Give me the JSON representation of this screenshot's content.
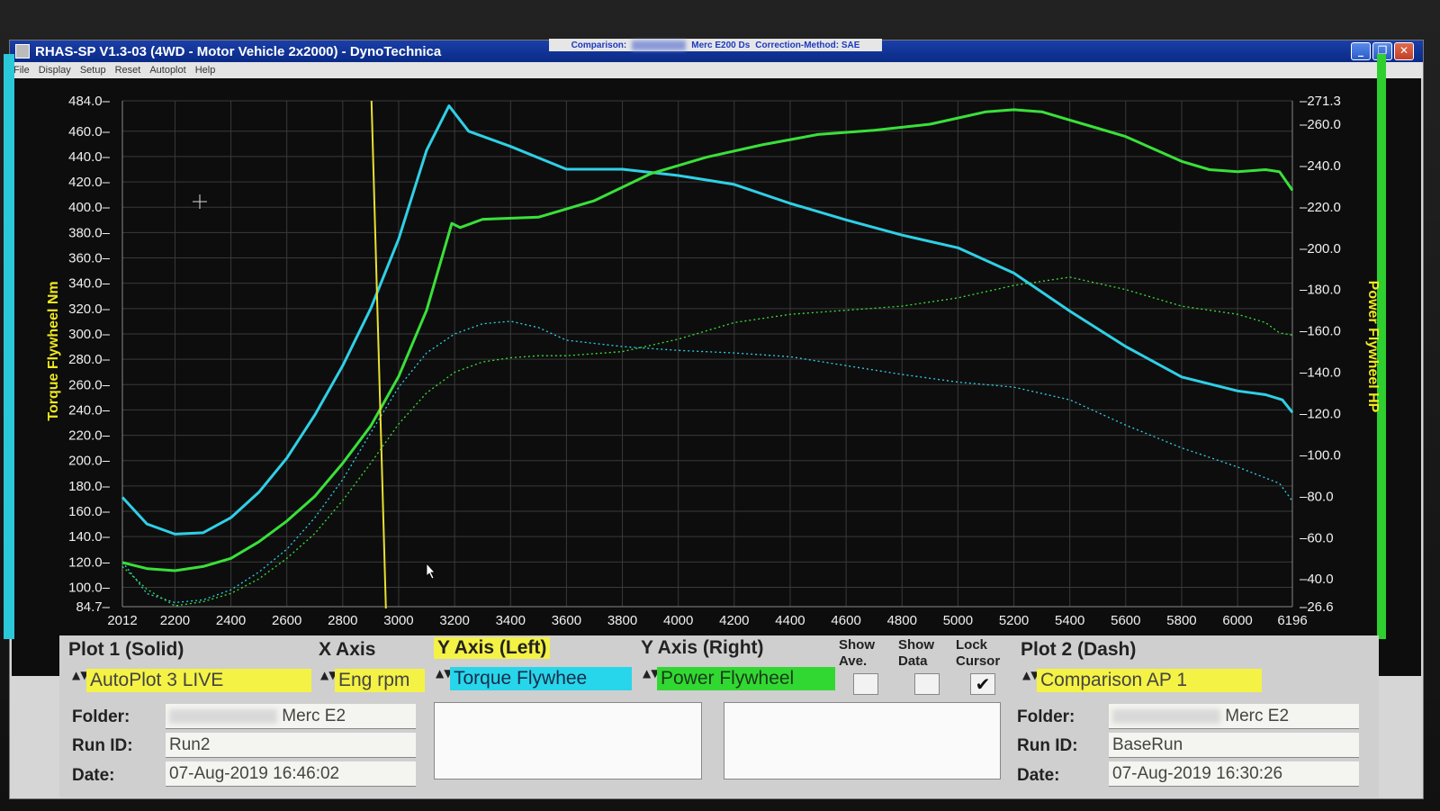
{
  "window": {
    "title": "RHAS-SP V1.3-03  (4WD - Motor Vehicle 2x2000) - DynoTechnica",
    "buttons": {
      "minimize": "_",
      "restore": "❐",
      "close": "✕"
    }
  },
  "menu": [
    "File",
    "Display",
    "Setup",
    "Reset",
    "Autoplot",
    "Help"
  ],
  "comparison_bar": {
    "label": "Comparison:",
    "run": "Merc E200 Ds",
    "method": "Correction-Method: SAE"
  },
  "chart_data": {
    "type": "line",
    "xlabel": "",
    "ylabel_left": "Torque Flywheel Nm",
    "ylabel_right": "Power Flywheel HP",
    "xlim": [
      2012,
      6196
    ],
    "ylim_left": [
      84.7,
      484.0
    ],
    "ylim_right": [
      26.6,
      271.3
    ],
    "x_ticks": [
      "2012",
      "2200",
      "2400",
      "2600",
      "2800",
      "3000",
      "3200",
      "3400",
      "3600",
      "3800",
      "4000",
      "4200",
      "4400",
      "4600",
      "4800",
      "5000",
      "5200",
      "5400",
      "5600",
      "5800",
      "6000",
      "6196"
    ],
    "y_left_ticks": [
      "484.0",
      "460.0",
      "440.0",
      "420.0",
      "400.0",
      "380.0",
      "360.0",
      "340.0",
      "320.0",
      "300.0",
      "280.0",
      "260.0",
      "240.0",
      "220.0",
      "200.0",
      "180.0",
      "160.0",
      "140.0",
      "120.0",
      "100.0",
      "84.7"
    ],
    "y_right_ticks": [
      "271.3",
      "260.0",
      "240.0",
      "220.0",
      "200.0",
      "180.0",
      "160.0",
      "140.0",
      "120.0",
      "100.0",
      "80.0",
      "60.0",
      "40.0",
      "26.6"
    ],
    "grid": true,
    "cursor_x": 2935,
    "series": [
      {
        "color": "#2fd0e6",
        "style": "solid",
        "axis": "left",
        "x": [
          2012,
          2100,
          2200,
          2300,
          2400,
          2500,
          2600,
          2700,
          2800,
          2900,
          3000,
          3100,
          3180,
          3250,
          3400,
          3600,
          3800,
          4000,
          4200,
          4400,
          4600,
          4800,
          5000,
          5200,
          5400,
          5600,
          5800,
          6000,
          6100,
          6160,
          6196
        ],
        "y": [
          171,
          150,
          142,
          143,
          155,
          175,
          202,
          236,
          275,
          320,
          375,
          445,
          480,
          460,
          448,
          430,
          430,
          425,
          418,
          403,
          390,
          378,
          368,
          348,
          318,
          290,
          266,
          255,
          252,
          248,
          238
        ]
      },
      {
        "color": "#2fd0e6",
        "style": "dash",
        "axis": "left",
        "x": [
          2012,
          2100,
          2200,
          2300,
          2400,
          2500,
          2600,
          2700,
          2800,
          2900,
          3000,
          3100,
          3200,
          3300,
          3400,
          3500,
          3600,
          3800,
          4000,
          4200,
          4400,
          4600,
          4800,
          5000,
          5200,
          5400,
          5600,
          5800,
          6000,
          6150,
          6196
        ],
        "y": [
          120,
          95,
          88,
          90,
          98,
          112,
          130,
          155,
          185,
          222,
          258,
          285,
          300,
          308,
          310,
          305,
          295,
          290,
          287,
          285,
          282,
          275,
          268,
          262,
          258,
          248,
          228,
          210,
          195,
          182,
          168
        ]
      },
      {
        "color": "#3ae03a",
        "style": "solid",
        "axis": "right",
        "x": [
          2012,
          2100,
          2200,
          2300,
          2400,
          2500,
          2600,
          2700,
          2800,
          2900,
          3000,
          3100,
          3190,
          3220,
          3300,
          3500,
          3700,
          3900,
          4100,
          4300,
          4500,
          4700,
          4900,
          5000,
          5100,
          5200,
          5300,
          5400,
          5500,
          5600,
          5700,
          5800,
          5900,
          6000,
          6100,
          6150,
          6196
        ],
        "y": [
          48,
          45,
          44,
          46,
          50,
          58,
          68,
          80,
          96,
          114,
          138,
          170,
          212,
          210,
          214,
          215,
          223,
          236,
          244,
          250,
          255,
          257,
          260,
          263,
          266,
          267,
          266,
          262,
          258,
          254,
          248,
          242,
          238,
          237,
          238,
          237,
          228
        ]
      },
      {
        "color": "#3ae03a",
        "style": "dash",
        "axis": "right",
        "x": [
          2012,
          2100,
          2200,
          2300,
          2400,
          2500,
          2600,
          2700,
          2800,
          2900,
          3000,
          3100,
          3200,
          3300,
          3400,
          3500,
          3600,
          3800,
          4000,
          4200,
          4400,
          4600,
          4800,
          5000,
          5200,
          5400,
          5600,
          5800,
          6000,
          6100,
          6150,
          6196
        ],
        "y": [
          46,
          35,
          27,
          29,
          33,
          40,
          50,
          62,
          78,
          96,
          115,
          130,
          140,
          145,
          147,
          148,
          148,
          150,
          156,
          164,
          168,
          170,
          172,
          176,
          182,
          186,
          180,
          172,
          168,
          164,
          159,
          158
        ]
      }
    ]
  },
  "controls": {
    "plot1": {
      "header": "Plot 1 (Solid)",
      "source": "AutoPlot 3 LIVE",
      "folder_label": "Folder:",
      "folder_value": "Merc E2",
      "runid_label": "Run ID:",
      "runid_value": "Run2",
      "date_label": "Date:",
      "date_value": "07-Aug-2019  16:46:02"
    },
    "x_axis": {
      "header": "X Axis",
      "value": "Eng rpm"
    },
    "y_left": {
      "header": "Y Axis (Left)",
      "value": "Torque Flywhee"
    },
    "y_right": {
      "header": "Y Axis (Right)",
      "value": "Power Flywheel"
    },
    "show_ave": {
      "line1": "Show",
      "line2": "Ave.",
      "checked": ""
    },
    "show_data": {
      "line1": "Show",
      "line2": "Data",
      "checked": ""
    },
    "lock_cursor": {
      "line1": "Lock",
      "line2": "Cursor",
      "checked": "✔"
    },
    "plot2": {
      "header": "Plot 2 (Dash)",
      "source": "Comparison AP 1",
      "folder_label": "Folder:",
      "folder_value": "Merc E2",
      "runid_label": "Run ID:",
      "runid_value": "BaseRun",
      "date_label": "Date:",
      "date_value": "07-Aug-2019  16:30:26"
    },
    "spin_glyph": "▲▼"
  }
}
